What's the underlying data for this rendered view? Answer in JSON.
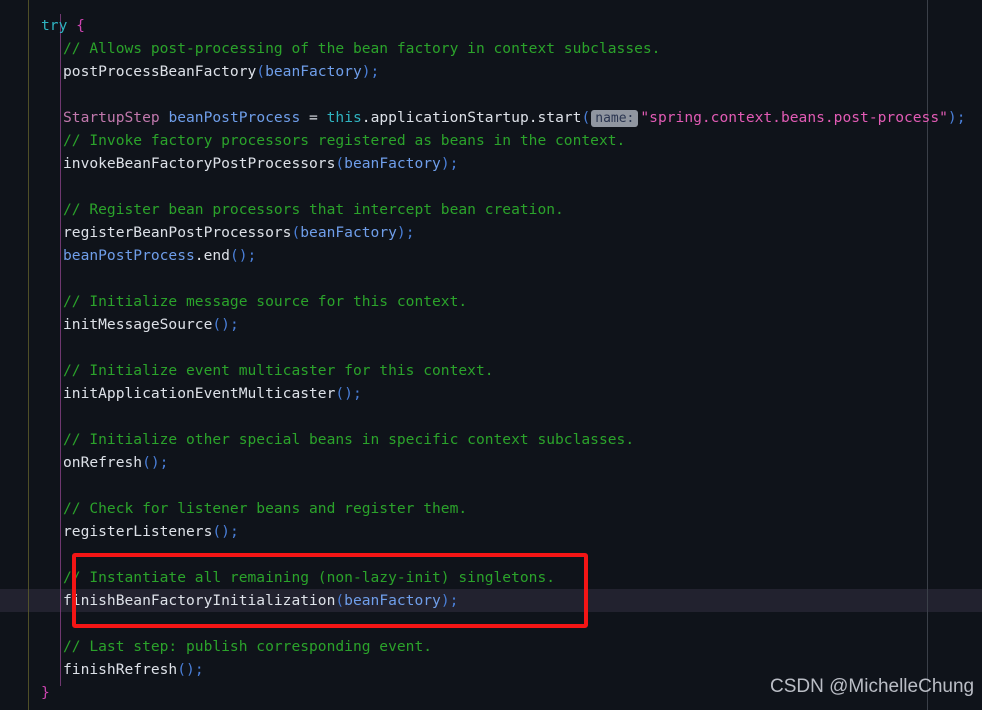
{
  "editor": {
    "background_color": "#0f131a",
    "current_line_highlight_color": "#22222f",
    "gutter_separator_color": "#5a5b2a",
    "indent_guide_color": "#7a3d7a",
    "margin_guide_color": "#3b4049",
    "language": "java"
  },
  "palette": {
    "keyword": "#2fb3c0",
    "brace": "#cc44b0",
    "comment": "#2ba32b",
    "identifier": "#dde1e8",
    "variable": "#6f9eea",
    "class_name": "#c178ad",
    "string": "#e25bb5",
    "parenthesis": "#4a7fd8",
    "annotation_box": "#f41515"
  },
  "code": {
    "l1_try": "try",
    "l1_brace": "{",
    "l2_comment": "// Allows post-processing of the bean factory in context subclasses.",
    "l3_method": "postProcessBeanFactory",
    "l3_open": "(",
    "l3_arg": "beanFactory",
    "l3_close": ")",
    "l3_semi": ";",
    "l5_type": "StartupStep",
    "l5_var": "beanPostProcess",
    "l5_eq": "=",
    "l5_this": "this",
    "l5_chain": ".applicationStartup.start",
    "l5_open": "(",
    "l5_hint": "name:",
    "l5_string": "\"spring.context.beans.post-process\"",
    "l5_close": ")",
    "l5_semi": ";",
    "l6_comment": "// Invoke factory processors registered as beans in the context.",
    "l7_method": "invokeBeanFactoryPostProcessors",
    "l7_open": "(",
    "l7_arg": "beanFactory",
    "l7_close": ")",
    "l7_semi": ";",
    "l9_comment": "// Register bean processors that intercept bean creation.",
    "l10_method": "registerBeanPostProcessors",
    "l10_open": "(",
    "l10_arg": "beanFactory",
    "l10_close": ")",
    "l10_semi": ";",
    "l11_var": "beanPostProcess",
    "l11_method": ".end",
    "l11_parens": "()",
    "l11_semi": ";",
    "l13_comment": "// Initialize message source for this context.",
    "l14_method": "initMessageSource",
    "l14_parens": "()",
    "l14_semi": ";",
    "l16_comment": "// Initialize event multicaster for this context.",
    "l17_method": "initApplicationEventMulticaster",
    "l17_parens": "()",
    "l17_semi": ";",
    "l19_comment": "// Initialize other special beans in specific context subclasses.",
    "l20_method": "onRefresh",
    "l20_parens": "()",
    "l20_semi": ";",
    "l22_comment": "// Check for listener beans and register them.",
    "l23_method": "registerListeners",
    "l23_parens": "()",
    "l23_semi": ";",
    "l25_comment": "// Instantiate all remaining (non-lazy-init) singletons.",
    "l26_method": "finishBeanFactoryInitialization",
    "l26_open": "(",
    "l26_arg": "beanFactory",
    "l26_close": ")",
    "l26_semi": ";",
    "l28_comment": "// Last step: publish corresponding event.",
    "l29_method": "finishRefresh",
    "l29_parens": "()",
    "l29_semi": ";",
    "l30_brace": "}"
  },
  "watermark": {
    "text": "CSDN @MichelleChung"
  }
}
